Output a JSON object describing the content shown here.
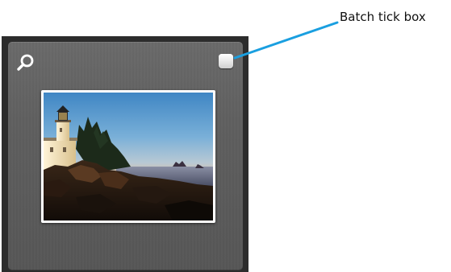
{
  "thumbnail": {
    "zoom_icon": "magnifier-icon",
    "batch_checkbox_checked": false,
    "photo_subject": "lighthouse-on-rocky-coast-at-sunset"
  },
  "annotation": {
    "label": "Batch tick box",
    "line_color": "#1a9fe0"
  },
  "colors": {
    "cell_background": "#5e5e5e",
    "outer_frame": "#2c2c2c",
    "photo_border": "#ffffff",
    "callout_line": "#1a9fe0"
  }
}
